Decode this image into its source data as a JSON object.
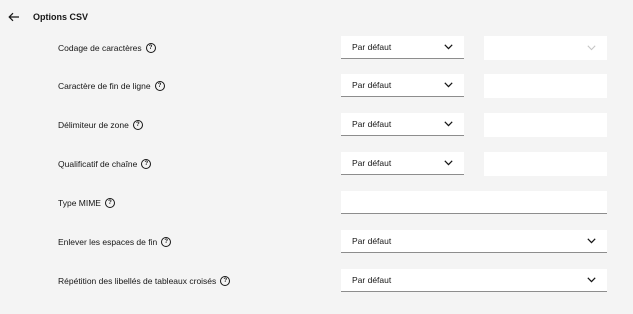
{
  "header": {
    "title": "Options CSV",
    "back_icon": "arrow-left-icon"
  },
  "rows": [
    {
      "label": "Codage de caractères",
      "select_value": "Par défaut",
      "secondary": "disabled-select"
    },
    {
      "label": "Caractère de fin de ligne",
      "select_value": "Par défaut",
      "secondary": "input"
    },
    {
      "label": "Délimiteur de zone",
      "select_value": "Par défaut",
      "secondary": "input"
    },
    {
      "label": "Qualificatif de chaîne",
      "select_value": "Par défaut",
      "secondary": "input"
    },
    {
      "label": "Type MIME",
      "input_value": ""
    },
    {
      "label": "Enlever les espaces de fin",
      "select_value": "Par défaut"
    },
    {
      "label": "Répétition des libellés de tableaux croisés",
      "select_value": "Par défaut"
    }
  ],
  "help_icon": "help-circle-icon",
  "help_glyph": "?",
  "colors": {
    "background": "#f4f4f4",
    "field": "#ffffff",
    "border": "#8d8d8d",
    "text": "#161616"
  }
}
